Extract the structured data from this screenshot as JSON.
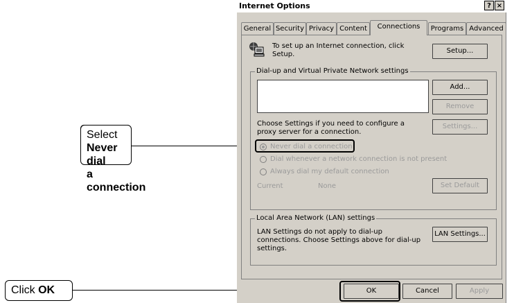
{
  "callouts": {
    "select_prefix": "Select ",
    "select_bold_1": "Never dial",
    "select_bold_2": "a connection",
    "click_prefix": "Click ",
    "click_bold": "OK"
  },
  "dialog": {
    "title": "Internet Options",
    "help_btn": "?",
    "close_btn": "×",
    "tabs": [
      "General",
      "Security",
      "Privacy",
      "Content",
      "Connections",
      "Programs",
      "Advanced"
    ],
    "active_tab": "Connections",
    "setup_text": "To set up an Internet connection, click Setup.",
    "setup_btn": "Setup...",
    "dialup_group": "Dial-up and Virtual Private Network settings",
    "add_btn": "Add...",
    "remove_btn": "Remove",
    "proxy_text": "Choose Settings if you need to configure a proxy server for a connection.",
    "settings_btn": "Settings...",
    "radios": [
      {
        "label": "Never dial a connection",
        "checked": true
      },
      {
        "label": "Dial whenever a network connection is not present",
        "checked": false
      },
      {
        "label": "Always dial my default connection",
        "checked": false
      }
    ],
    "current_label": "Current",
    "current_value": "None",
    "set_default_btn": "Set Default",
    "lan_group": "Local Area Network (LAN) settings",
    "lan_text": "LAN Settings do not apply to dial-up connections. Choose Settings above for dial-up settings.",
    "lan_btn": "LAN Settings...",
    "ok_btn": "OK",
    "cancel_btn": "Cancel",
    "apply_btn": "Apply"
  }
}
